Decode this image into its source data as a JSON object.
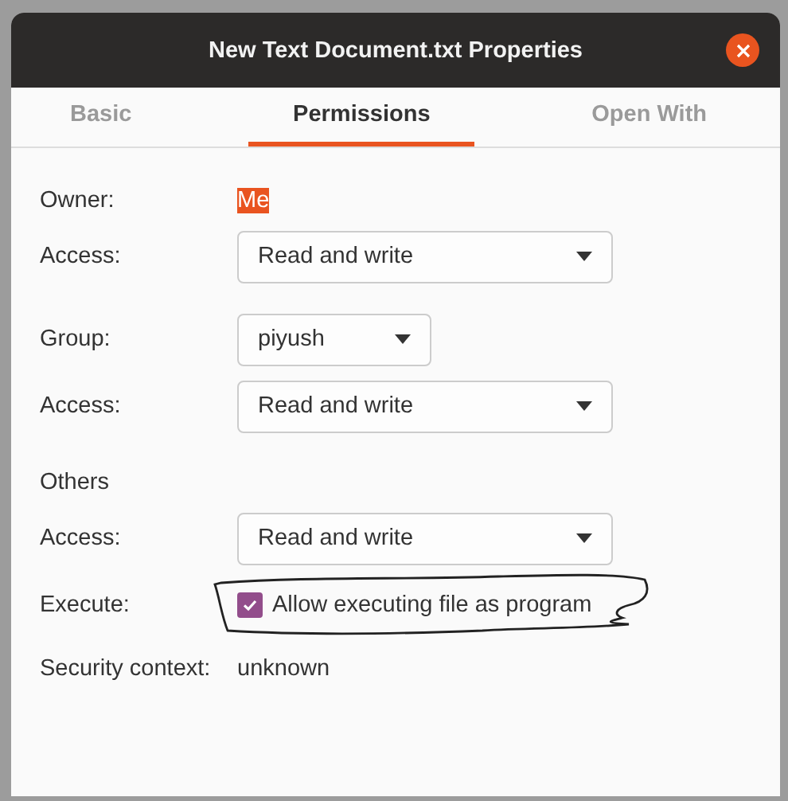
{
  "window": {
    "title": "New Text Document.txt Properties"
  },
  "tabs": [
    {
      "label": "Basic",
      "selected": false
    },
    {
      "label": "Permissions",
      "selected": true
    },
    {
      "label": "Open With",
      "selected": false
    }
  ],
  "rows": [
    {
      "kind": "text",
      "label": "Owner:",
      "value": "Me",
      "highlighted": true
    },
    {
      "kind": "combo",
      "label": "Access:",
      "value": "Read and write",
      "wide": true
    },
    {
      "kind": "spacer"
    },
    {
      "kind": "combo",
      "label": "Group:",
      "value": "piyush",
      "wide": false
    },
    {
      "kind": "combo",
      "label": "Access:",
      "value": "Read and write",
      "wide": true
    },
    {
      "kind": "spacer"
    },
    {
      "kind": "heading",
      "label": "Others"
    },
    {
      "kind": "combo",
      "label": "Access:",
      "value": "Read and write",
      "wide": true
    },
    {
      "kind": "checkbox",
      "label": "Execute:",
      "value": "Allow executing file as program",
      "checked": true
    },
    {
      "kind": "text",
      "label": "Security context:",
      "value": "unknown",
      "highlighted": false
    }
  ]
}
